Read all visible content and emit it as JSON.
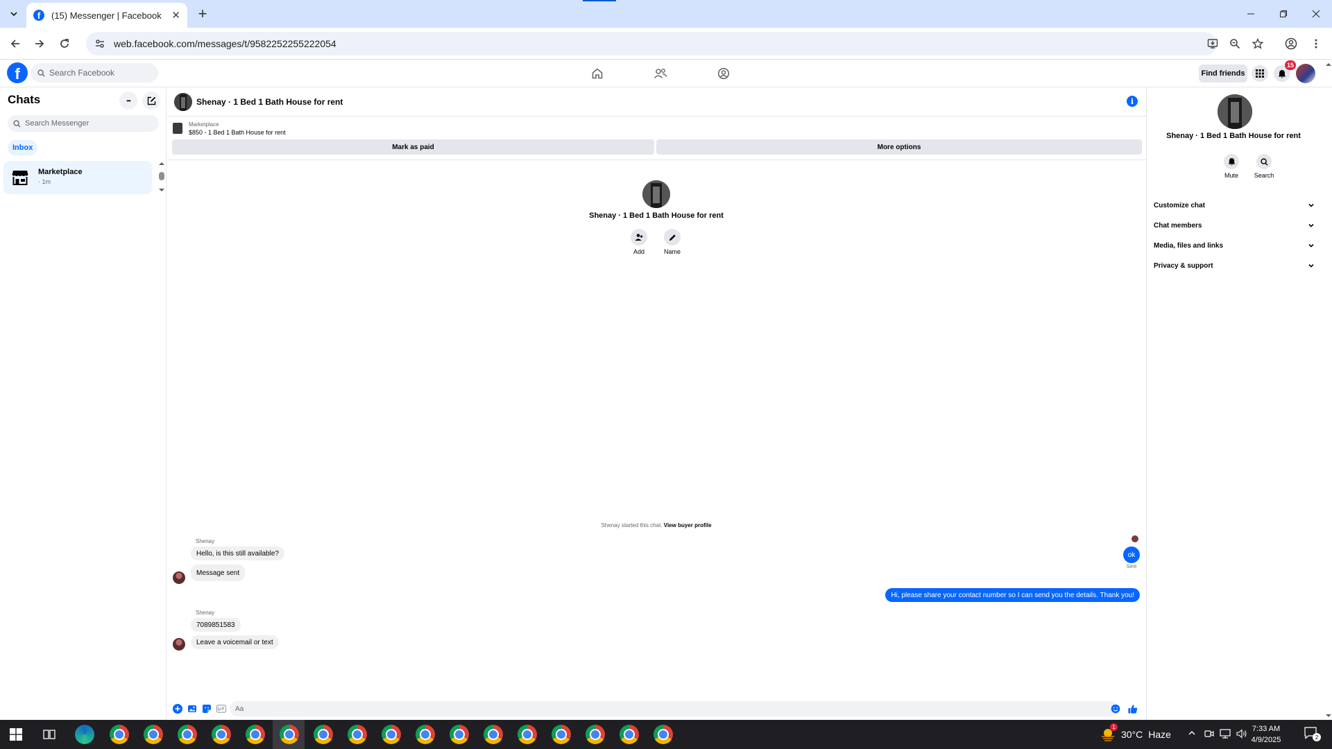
{
  "browser": {
    "tab_title": "(15) Messenger | Facebook",
    "tab_close": "✕",
    "new_tab": "+",
    "url": "web.facebook.com/messages/t/9582252255222054"
  },
  "fb": {
    "logo_letter": "f",
    "search_placeholder": "Search Facebook",
    "find_friends": "Find friends",
    "notification_count": "15"
  },
  "chats": {
    "title": "Chats",
    "more": "•••",
    "search_placeholder": "Search Messenger",
    "inbox_tab": "Inbox",
    "items": [
      {
        "name": "Marketplace",
        "time": "· 1m"
      }
    ]
  },
  "conversation": {
    "title": "Shenay · 1 Bed 1 Bath House for rent",
    "info": "i",
    "marketplace": {
      "label": "Marketplace",
      "listing": "$850 - 1 Bed 1 Bath House for rent",
      "mark_paid": "Mark as paid",
      "more_options": "More options"
    },
    "intro": {
      "name": "Shenay · 1 Bed 1 Bath House for rent",
      "add": "Add",
      "name_action": "Name"
    },
    "started_text": "Shenay started this chat.",
    "view_buyer_profile": "View buyer profile",
    "messages": [
      {
        "sender": "Shenay",
        "text": "Hello, is this still available?"
      },
      {
        "sender": "",
        "text": "Message sent"
      },
      {
        "sender": "me",
        "text": "Hi, please share your contact number so I can send you the details. Thank you!"
      },
      {
        "sender": "Shenay",
        "text": "7089851583"
      },
      {
        "sender": "",
        "text": "Leave a voicemail or text"
      },
      {
        "sender": "me",
        "text": "ok"
      }
    ],
    "sent_status": "Sent",
    "composer_placeholder": "Aa"
  },
  "details": {
    "name": "Shenay · 1 Bed 1 Bath House for rent",
    "mute": "Mute",
    "search": "Search",
    "sections": [
      "Customize chat",
      "Chat members",
      "Media, files and links",
      "Privacy & support"
    ]
  },
  "taskbar": {
    "temperature": "30°C",
    "weather": "Haze",
    "weather_badge": "1",
    "time": "7:33 AM",
    "date": "4/9/2025",
    "notifications": "2"
  },
  "colors": {
    "facebook_blue": "#0866ff",
    "tabbar": "#d3e3fd",
    "bubble_gray": "#f0f0f0",
    "badge_red": "#e41e3f"
  }
}
